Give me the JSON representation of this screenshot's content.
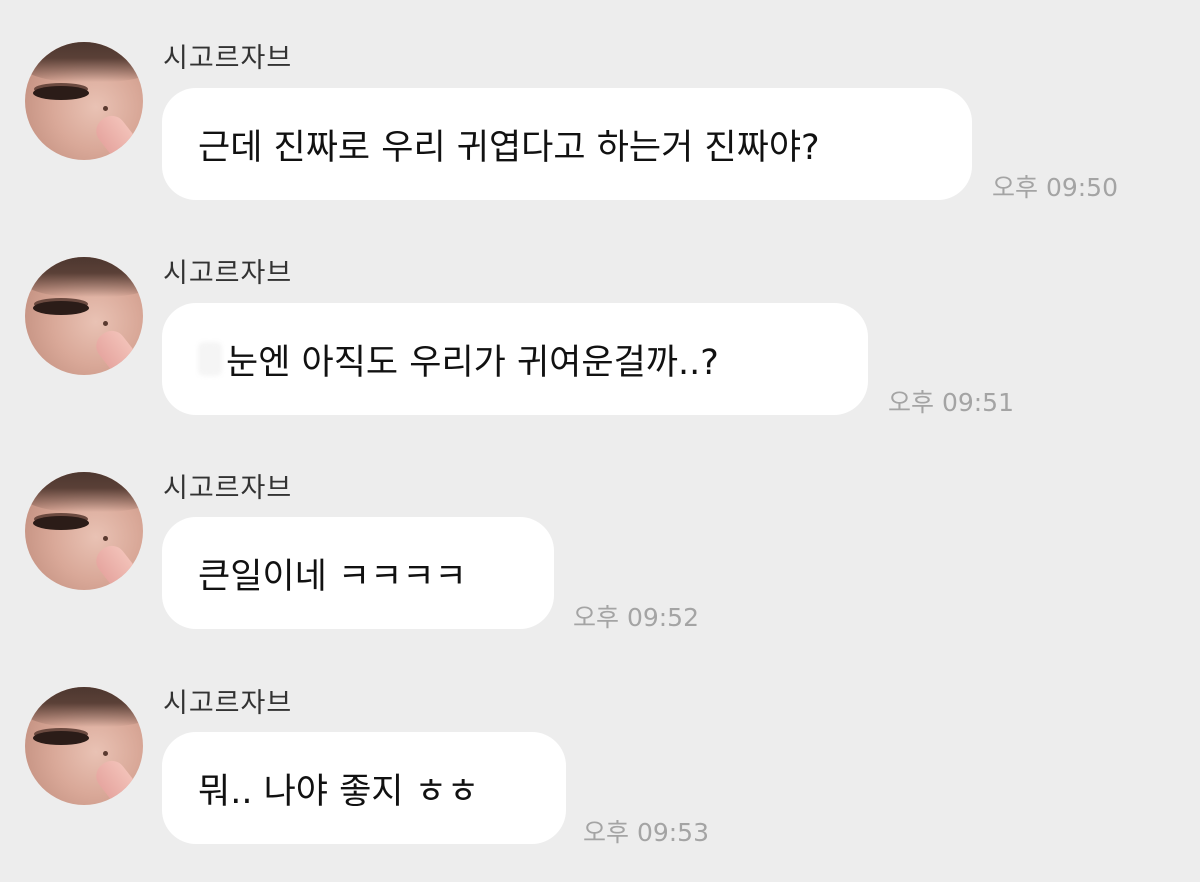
{
  "messages": [
    {
      "sender": "시고르자브",
      "text": "근데 진짜로 우리 귀엽다고 하는거 진짜야?",
      "time": "오후 09:50"
    },
    {
      "sender": "시고르자브",
      "text": "눈엔 아직도 우리가 귀여운걸까..?",
      "time": "오후 09:51"
    },
    {
      "sender": "시고르자브",
      "text": "큰일이네 ㅋㅋㅋㅋ",
      "time": "오후 09:52"
    },
    {
      "sender": "시고르자브",
      "text": "뭐.. 나야 좋지 ㅎㅎ",
      "time": "오후 09:53"
    }
  ],
  "colors": {
    "background": "#ededed",
    "bubble": "#ffffff",
    "time_text": "#a4a4a4",
    "message_text": "#111111"
  },
  "icons": {
    "avatar": "profile-photo-avatar"
  }
}
